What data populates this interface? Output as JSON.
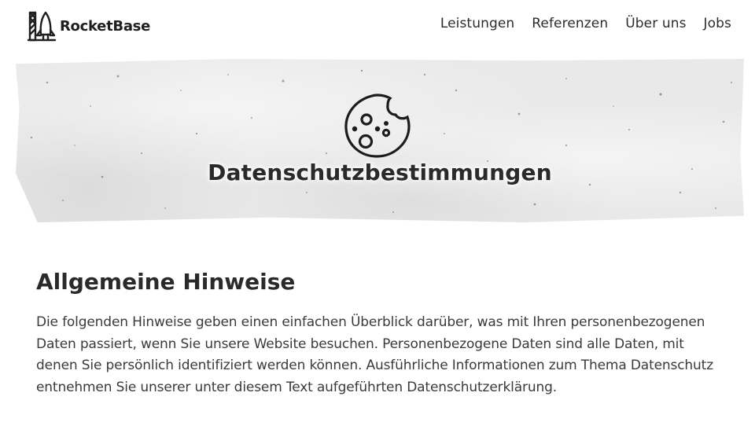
{
  "header": {
    "brand_name": "RocketBase",
    "logo_icon": "rocket-logo-icon",
    "nav": [
      {
        "label": "Leistungen"
      },
      {
        "label": "Referenzen"
      },
      {
        "label": "Über uns"
      },
      {
        "label": "Jobs"
      }
    ]
  },
  "hero": {
    "icon": "cookie-icon",
    "title": "Datenschutzbestimmungen"
  },
  "main": {
    "heading": "Allgemeine Hinweise",
    "paragraph": "Die folgenden Hinweise geben einen einfachen Überblick darüber, was mit Ihren personenbezogenen Daten passiert, wenn Sie unsere Website besuchen. Personenbezogene Daten sind alle Daten, mit denen Sie persönlich identifiziert werden können. Ausführliche Informationen zum Thema Datenschutz entnehmen Sie unserer unter diesem Text aufgeführten Datenschutzerklärung."
  },
  "colors": {
    "text": "#2b2b2b",
    "hero_bg": "#e9e9e9",
    "background": "#ffffff"
  }
}
